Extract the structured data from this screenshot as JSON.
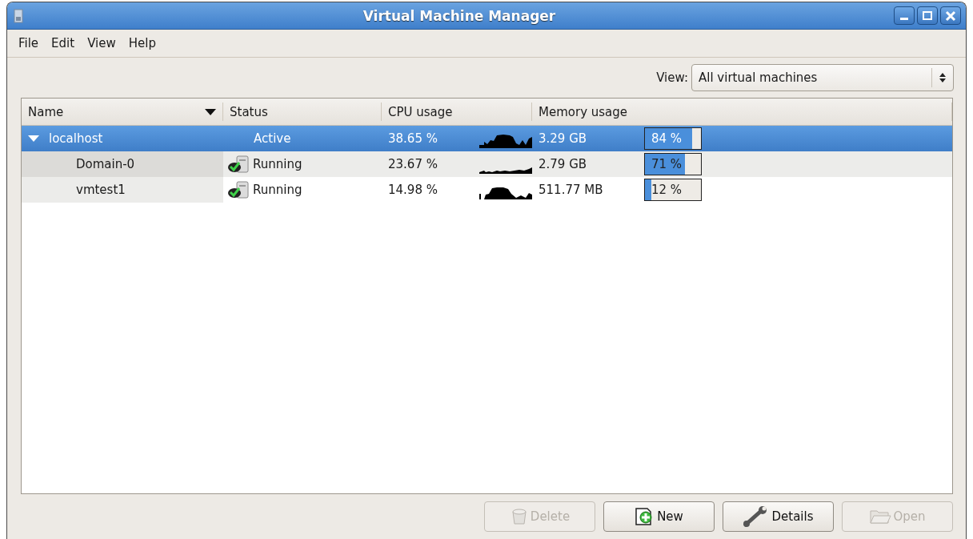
{
  "window": {
    "title": "Virtual Machine Manager"
  },
  "menu": [
    {
      "label": "File"
    },
    {
      "label": "Edit"
    },
    {
      "label": "View"
    },
    {
      "label": "Help"
    }
  ],
  "view_filter": {
    "label": "View:",
    "value": "All virtual machines"
  },
  "table": {
    "columns": [
      {
        "label": "Name",
        "sorted": true
      },
      {
        "label": "Status",
        "sorted": false
      },
      {
        "label": "CPU usage",
        "sorted": false
      },
      {
        "label": "Memory usage",
        "sorted": false
      }
    ],
    "rows": [
      {
        "kind": "host",
        "name": "localhost",
        "expanded": true,
        "selected": true,
        "status": "Active",
        "cpu": "38.65 %",
        "memory": "3.29 GB",
        "memory_bar": {
          "level": 0.84,
          "reading": "84 %"
        },
        "children": [
          {
            "kind": "vm",
            "name": "Domain-0",
            "selected": false,
            "status": "Running",
            "cpu": "23.67 %",
            "memory": "2.79 GB",
            "memory_bar": {
              "level": 0.71,
              "reading": "71 %"
            }
          },
          {
            "kind": "vm",
            "name": "vmtest1",
            "selected": false,
            "status": "Running",
            "cpu": "14.98 %",
            "memory": "511.77 MB",
            "memory_bar": {
              "level": 0.12,
              "reading": "12 %"
            }
          }
        ]
      }
    ]
  },
  "buttons": [
    {
      "kind": "delete",
      "label": "Delete",
      "disabled": true
    },
    {
      "kind": "new",
      "label": "New",
      "disabled": false
    },
    {
      "kind": "details",
      "label": "Details",
      "disabled": false
    },
    {
      "kind": "open",
      "label": "Open",
      "disabled": true
    }
  ]
}
